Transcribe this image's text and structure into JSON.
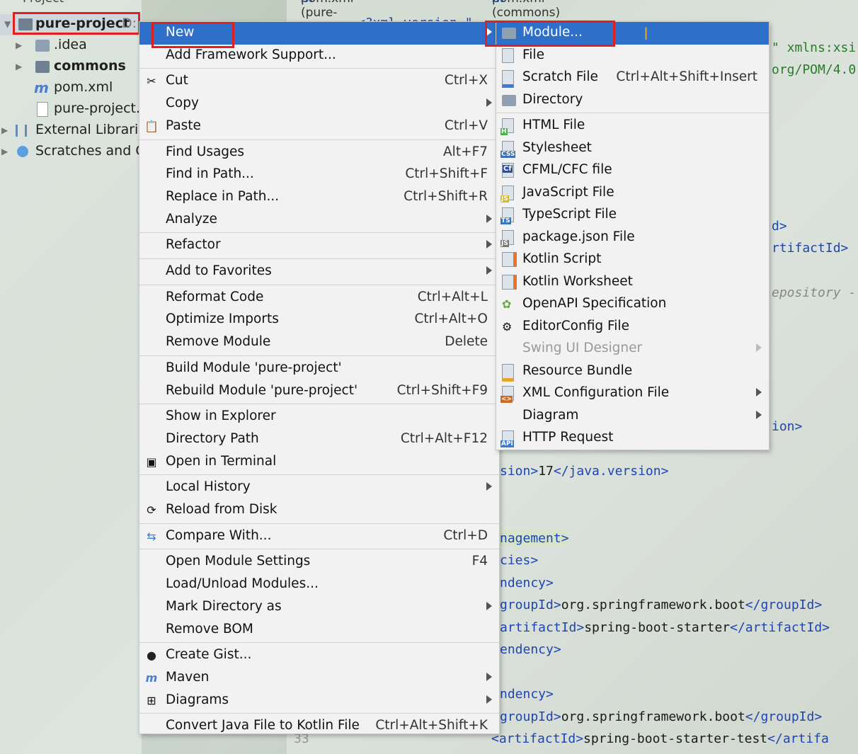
{
  "project_panel": {
    "header": "Project",
    "items": [
      {
        "label": "pure-project",
        "path": "D:"
      },
      {
        "label": ".idea"
      },
      {
        "label": "commons"
      },
      {
        "label": "pom.xml"
      },
      {
        "label": "pure-project.i"
      },
      {
        "label": "External Libraries"
      },
      {
        "label": "Scratches and Co"
      }
    ]
  },
  "editor_tabs": [
    "pom.xml (pure-project)",
    "pom.xml (commons)"
  ],
  "code_fragments": {
    "line_top": "<?xml version=\"",
    "xmlns": "\" xmlns:xsi",
    "pom_url": "org/POM/4.0",
    "d_close": "d>",
    "artifactid_close": "rtifactId>",
    "repository": "epository -",
    "ion_close": "ion>",
    "java_version": {
      "open": "sion>",
      "value": "17",
      "close": "</java.version>"
    },
    "management": "nagement>",
    "cies": "cies>",
    "ndency1": "ndency>",
    "groupId1": {
      "open": "groupId>",
      "value": "org.springframework.boot",
      "close": "</groupId>"
    },
    "artifactId1": {
      "open": "artifactId>",
      "value": "spring-boot-starter",
      "close": "</artifactId>"
    },
    "endency": "endency>",
    "ndency2": "ndency>",
    "groupId2": {
      "open": "groupId>",
      "value": "org.springframework.boot",
      "close": "</groupId>"
    },
    "artifactId2": {
      "open": "<artifactId>",
      "value": "spring-boot-starter-test",
      "close": "</artifa"
    },
    "line_number": "33"
  },
  "context_menu": {
    "items": [
      {
        "label": "New",
        "shortcut": "",
        "submenu": true,
        "selected": true
      },
      {
        "label": "Add Framework Support...",
        "shortcut": ""
      },
      {
        "label": "Cut",
        "shortcut": "Ctrl+X",
        "icon": "scissors-icon"
      },
      {
        "label": "Copy",
        "shortcut": "",
        "submenu": true
      },
      {
        "label": "Paste",
        "shortcut": "Ctrl+V",
        "icon": "clipboard-icon"
      },
      {
        "label": "Find Usages",
        "shortcut": "Alt+F7"
      },
      {
        "label": "Find in Path...",
        "shortcut": "Ctrl+Shift+F"
      },
      {
        "label": "Replace in Path...",
        "shortcut": "Ctrl+Shift+R"
      },
      {
        "label": "Analyze",
        "shortcut": "",
        "submenu": true
      },
      {
        "label": "Refactor",
        "shortcut": "",
        "submenu": true
      },
      {
        "label": "Add to Favorites",
        "shortcut": "",
        "submenu": true
      },
      {
        "label": "Reformat Code",
        "shortcut": "Ctrl+Alt+L"
      },
      {
        "label": "Optimize Imports",
        "shortcut": "Ctrl+Alt+O"
      },
      {
        "label": "Remove Module",
        "shortcut": "Delete"
      },
      {
        "label": "Build Module 'pure-project'",
        "shortcut": ""
      },
      {
        "label": "Rebuild Module 'pure-project'",
        "shortcut": "Ctrl+Shift+F9"
      },
      {
        "label": "Show in Explorer",
        "shortcut": ""
      },
      {
        "label": "Directory Path",
        "shortcut": "Ctrl+Alt+F12"
      },
      {
        "label": "Open in Terminal",
        "shortcut": "",
        "icon": "terminal-icon"
      },
      {
        "label": "Local History",
        "shortcut": "",
        "submenu": true
      },
      {
        "label": "Reload from Disk",
        "shortcut": "",
        "icon": "reload-icon"
      },
      {
        "label": "Compare With...",
        "shortcut": "Ctrl+D",
        "icon": "compare-icon"
      },
      {
        "label": "Open Module Settings",
        "shortcut": "F4"
      },
      {
        "label": "Load/Unload Modules...",
        "shortcut": ""
      },
      {
        "label": "Mark Directory as",
        "shortcut": "",
        "submenu": true
      },
      {
        "label": "Remove BOM",
        "shortcut": ""
      },
      {
        "label": "Create Gist...",
        "shortcut": "",
        "icon": "github-icon"
      },
      {
        "label": "Maven",
        "shortcut": "",
        "submenu": true,
        "icon": "maven-icon"
      },
      {
        "label": "Diagrams",
        "shortcut": "",
        "submenu": true,
        "icon": "diagram-icon"
      },
      {
        "label": "Convert Java File to Kotlin File",
        "shortcut": "Ctrl+Alt+Shift+K"
      }
    ]
  },
  "new_submenu": {
    "items": [
      {
        "label": "Module...",
        "shortcut": "",
        "selected": true,
        "icon": "module-folder-icon"
      },
      {
        "label": "File",
        "shortcut": "",
        "icon": "file-icon"
      },
      {
        "label": "Scratch File",
        "shortcut": "Ctrl+Alt+Shift+Insert",
        "icon": "scratch-file-icon"
      },
      {
        "label": "Directory",
        "shortcut": "",
        "icon": "folder-icon"
      },
      {
        "label": "HTML File",
        "shortcut": "",
        "icon": "html-file-icon",
        "badge": "H"
      },
      {
        "label": "Stylesheet",
        "shortcut": "",
        "icon": "css-file-icon",
        "badge": "CSS"
      },
      {
        "label": "CFML/CFC file",
        "shortcut": "",
        "icon": "cfml-file-icon",
        "badge": "Cf"
      },
      {
        "label": "JavaScript File",
        "shortcut": "",
        "icon": "javascript-file-icon",
        "badge": "JS"
      },
      {
        "label": "TypeScript File",
        "shortcut": "",
        "icon": "typescript-file-icon",
        "badge": "TS"
      },
      {
        "label": "package.json File",
        "shortcut": "",
        "icon": "nodejs-icon",
        "badge": "JS"
      },
      {
        "label": "Kotlin Script",
        "shortcut": "",
        "icon": "kotlin-script-icon"
      },
      {
        "label": "Kotlin Worksheet",
        "shortcut": "",
        "icon": "kotlin-worksheet-icon"
      },
      {
        "label": "OpenAPI Specification",
        "shortcut": "",
        "icon": "openapi-icon"
      },
      {
        "label": "EditorConfig File",
        "shortcut": "",
        "icon": "gear-icon"
      },
      {
        "label": "Swing UI Designer",
        "shortcut": "",
        "submenu": true,
        "disabled": true
      },
      {
        "label": "Resource Bundle",
        "shortcut": "",
        "icon": "resource-bundle-icon"
      },
      {
        "label": "XML Configuration File",
        "shortcut": "",
        "submenu": true,
        "icon": "xml-file-icon",
        "badge": "<>"
      },
      {
        "label": "Diagram",
        "shortcut": "",
        "submenu": true
      },
      {
        "label": "HTTP Request",
        "shortcut": "",
        "icon": "http-request-icon",
        "badge": "API"
      }
    ]
  },
  "colors": {
    "selection": "#2e6fc9",
    "highlight_box": "#e02020",
    "xml_tag": "#1e45b0"
  }
}
